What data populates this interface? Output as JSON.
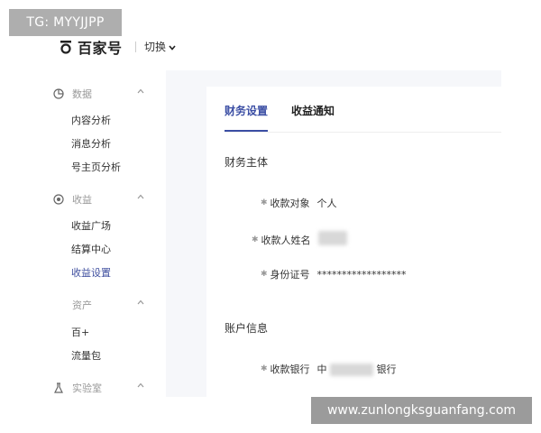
{
  "watermark_top": "TG: MYYJJPP",
  "watermark_bottom": "www.zunlongksguanfang.com",
  "header": {
    "logo_text": "百家号",
    "switch_label": "切换"
  },
  "sidebar": {
    "data_group": {
      "label": "数据",
      "items": [
        "内容分析",
        "消息分析",
        "号主页分析"
      ]
    },
    "income_group": {
      "label": "收益",
      "items": [
        "收益广场",
        "结算中心",
        "收益设置"
      ]
    },
    "asset_group": {
      "label": "资产",
      "items": [
        "百+",
        "流量包"
      ]
    },
    "lab_group": {
      "label": "实验室"
    }
  },
  "main": {
    "tabs": [
      {
        "label": "财务设置"
      },
      {
        "label": "收益通知"
      }
    ],
    "section1_title": "财务主体",
    "fields1": [
      {
        "label": "收款对象",
        "value": "个人"
      },
      {
        "label": "收款人姓名",
        "value": ""
      },
      {
        "label": "身份证号",
        "value": "******************"
      }
    ],
    "section2_title": "账户信息",
    "fields2": [
      {
        "label": "收款银行",
        "value_prefix": "中",
        "value_suffix": "银行"
      }
    ]
  }
}
